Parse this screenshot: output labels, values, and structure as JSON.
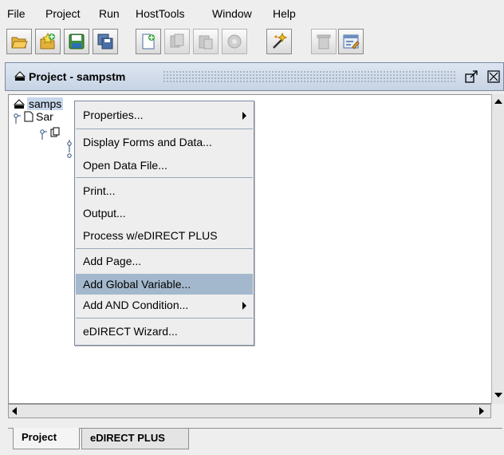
{
  "menubar": {
    "items": [
      "File",
      "Project",
      "Run",
      "HostTools",
      "Window",
      "Help"
    ]
  },
  "toolbar": {
    "buttons": [
      {
        "icon": "open-folder-icon",
        "enabled": true
      },
      {
        "icon": "new-project-icon",
        "enabled": true
      },
      {
        "icon": "save-icon",
        "enabled": true
      },
      {
        "icon": "save-all-icon",
        "enabled": true
      },
      {
        "icon": "new-page-icon",
        "enabled": true
      },
      {
        "icon": "copy-page-icon",
        "enabled": false
      },
      {
        "icon": "paste-page-icon",
        "enabled": false
      },
      {
        "icon": "run-icon",
        "enabled": false
      },
      {
        "icon": "wizard-icon",
        "enabled": true
      },
      {
        "icon": "delete-icon",
        "enabled": false
      },
      {
        "icon": "properties-icon",
        "enabled": true
      }
    ]
  },
  "panel": {
    "title": "Project - sampstm"
  },
  "tree": {
    "root_label": "samps",
    "child_label": "Sar"
  },
  "context_menu": {
    "items": [
      {
        "label": "Properties...",
        "submenu": true
      },
      {
        "label": "Display Forms and Data...",
        "submenu": false
      },
      {
        "label": "Open Data File...",
        "submenu": false
      },
      {
        "label": "Print...",
        "submenu": false
      },
      {
        "label": "Output...",
        "submenu": false
      },
      {
        "label": "Process w/eDIRECT PLUS",
        "submenu": false
      },
      {
        "label": "Add Page...",
        "submenu": false
      },
      {
        "label": "Add Global Variable...",
        "submenu": false,
        "highlighted": true
      },
      {
        "label": "Add AND Condition...",
        "submenu": true
      },
      {
        "label": "eDIRECT Wizard...",
        "submenu": false
      }
    ]
  },
  "tabs": [
    {
      "label": "Project",
      "active": true
    },
    {
      "label": "eDIRECT PLUS",
      "active": false
    }
  ],
  "colors": {
    "menu_highlight": "#a3b8cc",
    "titlebar": "#c7d3e4"
  }
}
